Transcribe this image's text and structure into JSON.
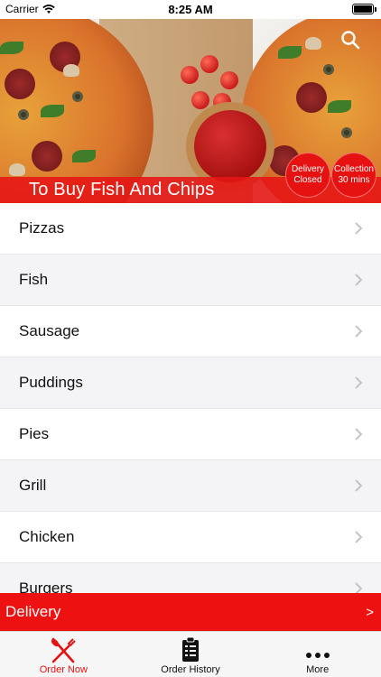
{
  "status_bar": {
    "carrier": "Carrier",
    "time": "8:25 AM"
  },
  "hero": {
    "title": "To Buy Fish And Chips",
    "delivery_badge": {
      "line1": "Delivery",
      "line2": "Closed"
    },
    "collection_badge": {
      "line1": "Collection",
      "line2": "30 mins"
    }
  },
  "menu": {
    "items": [
      {
        "label": "Pizzas"
      },
      {
        "label": "Fish"
      },
      {
        "label": "Sausage"
      },
      {
        "label": "Puddings"
      },
      {
        "label": "Pies"
      },
      {
        "label": "Grill"
      },
      {
        "label": "Chicken"
      },
      {
        "label": "Burgers"
      }
    ]
  },
  "delivery_bar": {
    "label": "Delivery",
    "arrow": ">"
  },
  "tab_bar": {
    "tabs": [
      {
        "label": "Order Now",
        "icon": "fork-knife-icon",
        "active": true
      },
      {
        "label": "Order History",
        "icon": "clipboard-list-icon",
        "active": false
      },
      {
        "label": "More",
        "icon": "more-dots-icon",
        "active": false
      }
    ]
  },
  "colors": {
    "accent": "#e61212",
    "delivery_bar": "#ee1111",
    "list_alt_row": "#f4f4f6"
  }
}
